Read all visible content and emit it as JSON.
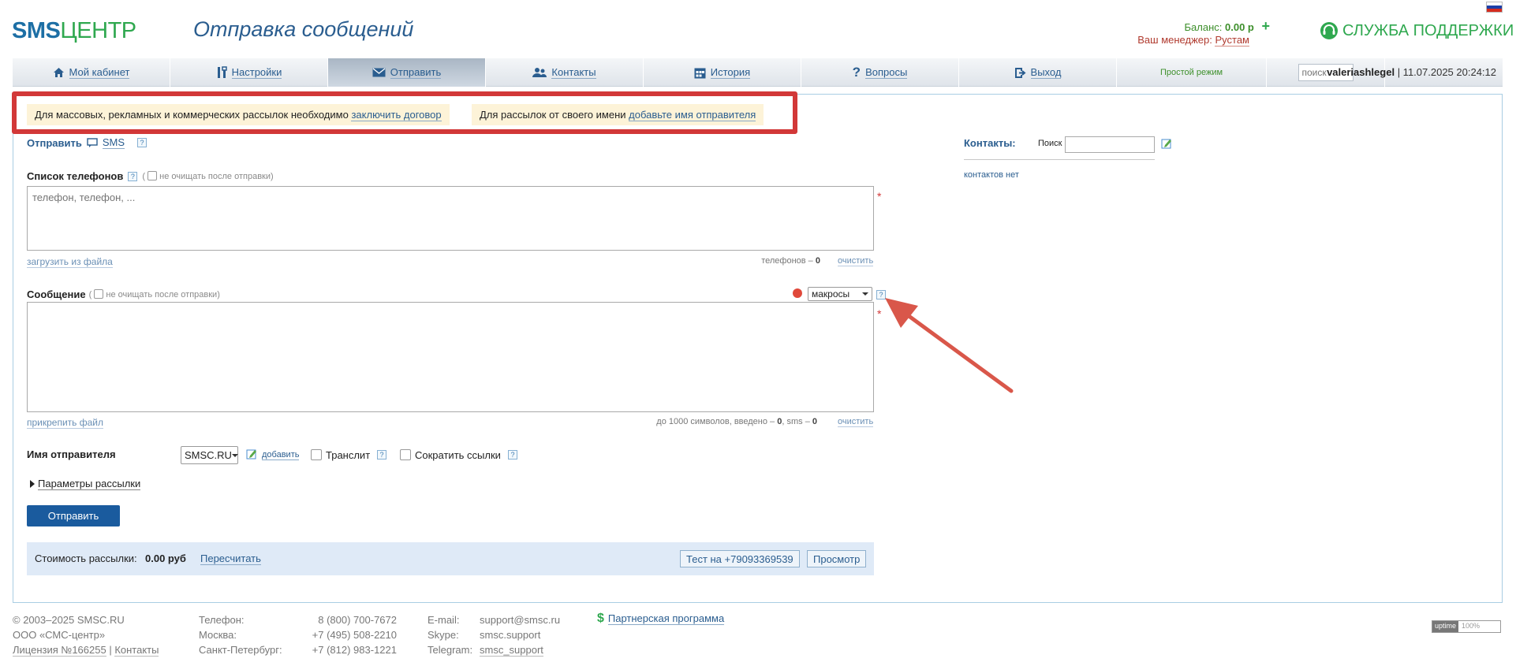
{
  "header": {
    "logo_sms": "SMS",
    "logo_center": "ЦЕНТР",
    "page_title": "Отправка сообщений",
    "balance_label": "Баланс:",
    "balance_value": "0.00 р",
    "manager_label": "Ваш менеджер:",
    "manager_name": "Рустам",
    "support_label": "СЛУЖБА ПОДДЕРЖКИ"
  },
  "nav": {
    "items": [
      {
        "label": "Мой кабинет",
        "icon": "home-icon"
      },
      {
        "label": "Настройки",
        "icon": "tools-icon"
      },
      {
        "label": "Отправить",
        "icon": "envelope-icon"
      },
      {
        "label": "Контакты",
        "icon": "users-icon"
      },
      {
        "label": "История",
        "icon": "calendar-icon"
      },
      {
        "label": "Вопросы",
        "icon": "question-icon"
      },
      {
        "label": "Выход",
        "icon": "exit-icon"
      }
    ],
    "simple_mode": "Простой режим",
    "search_placeholder": "поиск",
    "username": "valeriashlegel",
    "datetime": "| 11.07.2025 20:24:12"
  },
  "notices": {
    "contract_text": "Для массовых, рекламных и коммерческих рассылок необходимо",
    "contract_link": "заключить договор",
    "sender_text": "Для рассылок от своего имени",
    "sender_link": "добавьте имя отправителя"
  },
  "send": {
    "title": "Отправить",
    "type": "SMS",
    "phones_label": "Список телефонов",
    "no_clear_label": "не очищать после отправки",
    "phones_placeholder": "телефон, телефон, ...",
    "load_file": "загрузить из файла",
    "phones_count_label": "телефонов –",
    "phones_count": "0",
    "clear": "очистить",
    "message_label": "Сообщение",
    "macros": "макросы",
    "attach_file": "прикрепить файл",
    "message_stats_prefix": "до 1000 символов, введено –",
    "chars": "0",
    "sms_label": ", sms –",
    "sms": "0",
    "sender_label": "Имя отправителя",
    "sender_value": "SMSC.RU",
    "add": "добавить",
    "translit": "Транслит",
    "shorten_links": "Сократить ссылки",
    "params": "Параметры рассылки",
    "send_button": "Отправить"
  },
  "cost": {
    "label": "Стоимость рассылки:",
    "value": "0.00 руб",
    "recalc": "Пересчитать",
    "test_button": "Тест на +79093369539",
    "preview_button": "Просмотр"
  },
  "contacts": {
    "title": "Контакты:",
    "search_label": "Поиск",
    "empty": "контактов нет"
  },
  "footer": {
    "copyright": "© 2003–2025 SMSC.RU",
    "company": "ООО «СМС-центр»",
    "license": "Лицензия №166255",
    "contacts_link": "Контакты",
    "phone_label": "Телефон:",
    "phone": "8 (800) 700-7672",
    "moscow_label": "Москва:",
    "moscow": "+7 (495) 508-2210",
    "spb_label": "Санкт-Петербург:",
    "spb": "+7 (812) 983-1221",
    "email_label": "E-mail:",
    "email": "support@smsc.ru",
    "skype_label": "Skype:",
    "skype": "smsc.support",
    "telegram_label": "Telegram:",
    "telegram": "smsc_support",
    "partner": "Партнерская программа",
    "uptime_label": "uptime",
    "uptime_value": "100%"
  },
  "colors": {
    "brand_blue": "#1d6fa5",
    "brand_green": "#2fa84f",
    "highlight_red": "#d23838",
    "send_button": "#1a5b9e"
  }
}
